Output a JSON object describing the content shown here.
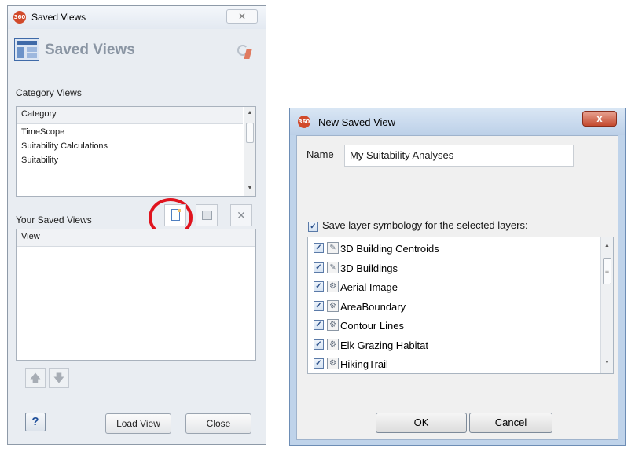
{
  "left_window": {
    "title": "Saved Views",
    "logo_text": "360",
    "close_glyph": "✕",
    "header_title": "Saved Views",
    "category_label": "Category Views",
    "category_column": "Category",
    "categories": [
      "TimeScope",
      "Suitability Calculations",
      "Suitability"
    ],
    "saved_label": "Your Saved Views",
    "view_column": "View",
    "load_button": "Load View",
    "close_button": "Close",
    "help_glyph": "?",
    "delete_glyph": "✕",
    "highlight_color": "#e0141e"
  },
  "dialog": {
    "title": "New Saved View",
    "logo_text": "360",
    "close_glyph": "x",
    "name_label": "Name",
    "name_value": "My Suitability Analyses",
    "save_symbology_label": "Save layer symbology for the selected layers:",
    "check_glyph": "✓",
    "layers": [
      {
        "label": "3D Building Centroids",
        "icon": "edit-layer-icon",
        "checked": true
      },
      {
        "label": "3D Buildings",
        "icon": "edit-layer-icon",
        "checked": true
      },
      {
        "label": "Aerial Image",
        "icon": "gear-layer-icon",
        "checked": true
      },
      {
        "label": "AreaBoundary",
        "icon": "gear-layer-icon",
        "checked": true
      },
      {
        "label": "Contour Lines",
        "icon": "gear-layer-icon",
        "checked": true
      },
      {
        "label": "Elk Grazing Habitat",
        "icon": "gear-layer-icon",
        "checked": true
      },
      {
        "label": "HikingTrail",
        "icon": "gear-layer-icon",
        "checked": true
      }
    ],
    "ok_button": "OK",
    "cancel_button": "Cancel"
  }
}
